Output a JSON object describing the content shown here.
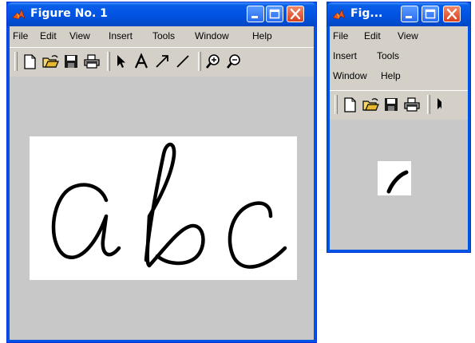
{
  "colors": {
    "titlebar": "#0054e3",
    "window_bg": "#d4d0c8",
    "figure_bg": "#c8c8c8",
    "axes_bg": "#ffffff",
    "stroke": "#000000",
    "close_button": "#d8421e"
  },
  "window_main": {
    "title": "Figure No. 1",
    "menu": [
      "File",
      "Edit",
      "View",
      "Insert",
      "Tools",
      "Window",
      "Help"
    ],
    "toolbar_icons": [
      "new-file-icon",
      "open-folder-icon",
      "save-icon",
      "print-icon",
      "select-arrow-icon",
      "text-icon",
      "arrow-icon",
      "line-icon",
      "zoom-in-icon",
      "zoom-out-icon"
    ],
    "plot_text": "abc"
  },
  "window_small": {
    "title": "Fig...",
    "menu": [
      "File",
      "Edit",
      "View",
      "Insert",
      "Tools",
      "Window",
      "Help"
    ],
    "toolbar_icons": [
      "new-file-icon",
      "open-folder-icon",
      "save-icon",
      "print-icon",
      "select-arrow-icon"
    ]
  }
}
